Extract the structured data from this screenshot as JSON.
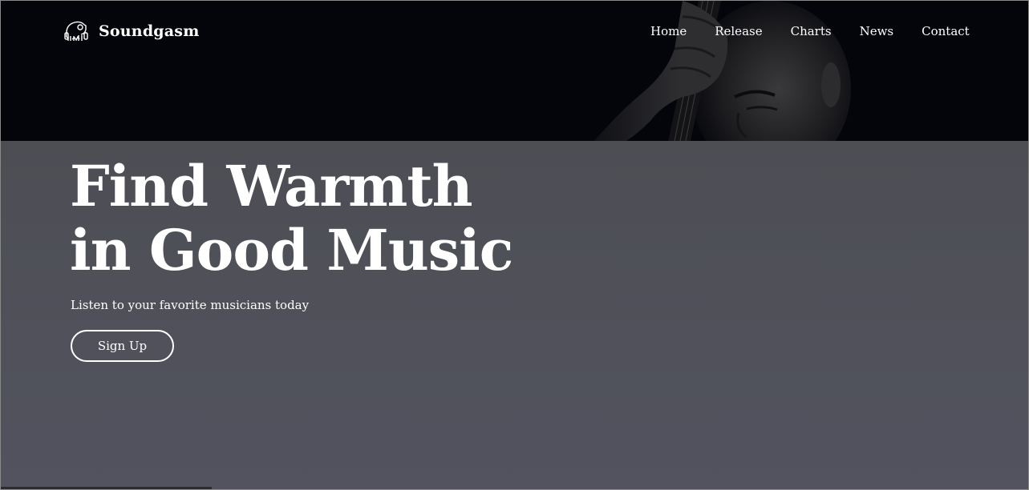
{
  "brand": {
    "name": "Soundgasm",
    "logo_icon": "elephant-headphones-icon"
  },
  "nav": {
    "items": [
      {
        "label": "Home"
      },
      {
        "label": "Release"
      },
      {
        "label": "Charts"
      },
      {
        "label": "News"
      },
      {
        "label": "Contact"
      }
    ]
  },
  "hero": {
    "headline_line1": "Find Warmth",
    "headline_line2": "in Good Music",
    "subline": "Listen to your favorite musicians today",
    "cta_label": "Sign Up",
    "photo": "musician-with-guitar-photo"
  },
  "colors": {
    "header_bg": "#04050a",
    "hero_bg": "#4e5058",
    "text": "#ffffff"
  }
}
